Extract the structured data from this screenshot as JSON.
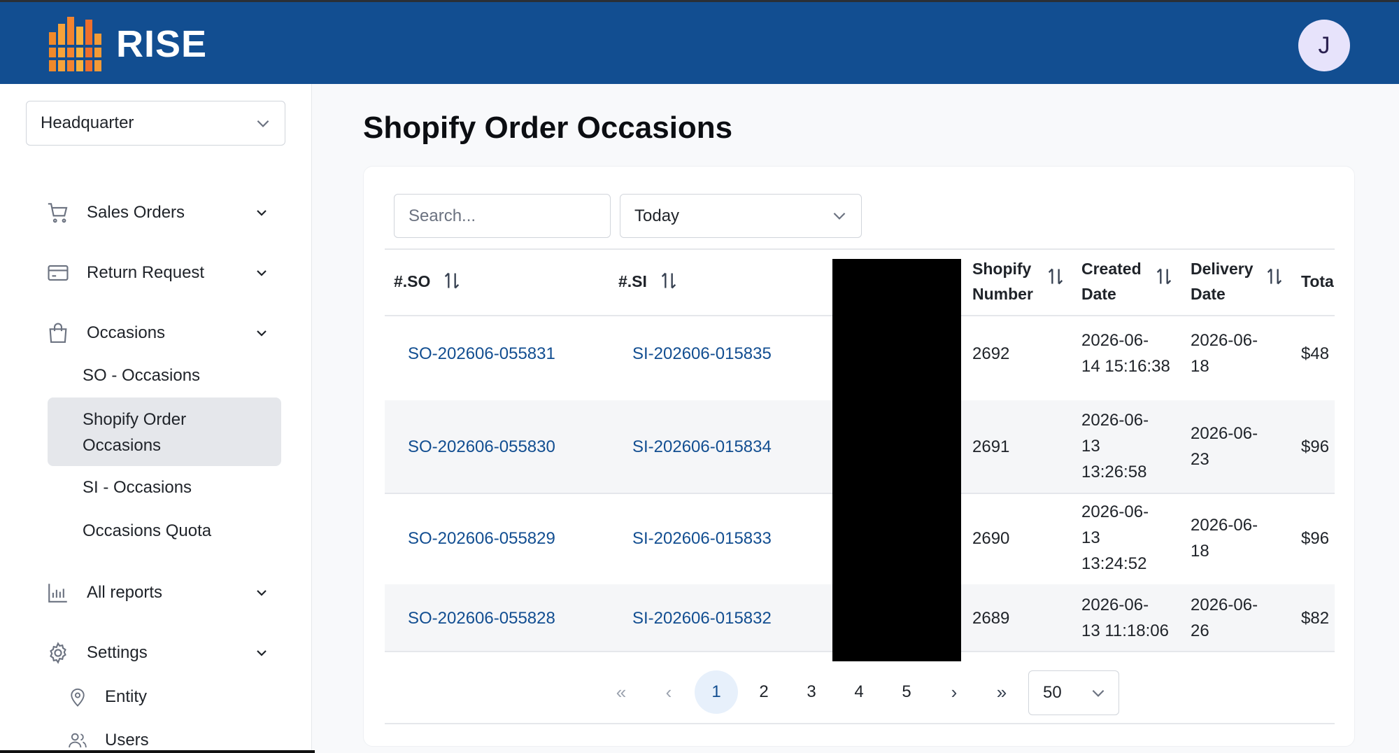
{
  "header": {
    "app_name": "RISE",
    "avatar_initial": "J",
    "brand_color": "#124e91"
  },
  "sidebar": {
    "location_select": "Headquarter",
    "items": [
      {
        "label": "Sales Orders",
        "icon": "cart-icon"
      },
      {
        "label": "Return Request",
        "icon": "credit-card-icon"
      },
      {
        "label": "Occasions",
        "icon": "shopping-bag-icon"
      }
    ],
    "occasions_sub": [
      "SO - Occasions",
      "Shopify Order Occasions",
      "SI - Occasions",
      "Occasions Quota"
    ],
    "reports": {
      "label": "All reports",
      "icon": "bar-chart-icon"
    },
    "settings": {
      "label": "Settings",
      "icon": "gear-icon"
    },
    "settings_sub": [
      {
        "label": "Entity",
        "icon": "map-pin-icon"
      },
      {
        "label": "Users",
        "icon": "users-icon"
      }
    ]
  },
  "main": {
    "title": "Shopify Order Occasions",
    "search": {
      "placeholder": "Search..."
    },
    "date_filter": "Today",
    "columns": [
      "#.SO",
      "#.SI",
      "",
      "Shopify Number",
      "Created Date",
      "Delivery Date",
      "Tota"
    ],
    "rows": [
      {
        "so": "SO-202606-055831",
        "si": "SI-202606-015835",
        "shopify": "2692",
        "created": [
          "2026-06-",
          "14 15:16:38"
        ],
        "delivery": [
          "2026-06-",
          "18"
        ],
        "total": "$48"
      },
      {
        "so": "SO-202606-055830",
        "si": "SI-202606-015834",
        "shopify": "2691",
        "created": [
          "2026-06-",
          "13",
          "13:26:58"
        ],
        "delivery": [
          "2026-06-",
          "23"
        ],
        "total": "$96"
      },
      {
        "so": "SO-202606-055829",
        "si": "SI-202606-015833",
        "shopify": "2690",
        "created": [
          "2026-06-",
          "13",
          "13:24:52"
        ],
        "delivery": [
          "2026-06-",
          "18"
        ],
        "total": "$96"
      },
      {
        "so": "SO-202606-055828",
        "si": "SI-202606-015832",
        "shopify": "2689",
        "created": [
          "2026-06-",
          "13 11:18:06"
        ],
        "delivery": [
          "2026-06-",
          "26"
        ],
        "total": "$82"
      }
    ],
    "pagination": {
      "first": "«",
      "prev": "‹",
      "pages": [
        "1",
        "2",
        "3",
        "4",
        "5"
      ],
      "next": "›",
      "last": "»",
      "current": "1",
      "per_page": "50"
    }
  }
}
